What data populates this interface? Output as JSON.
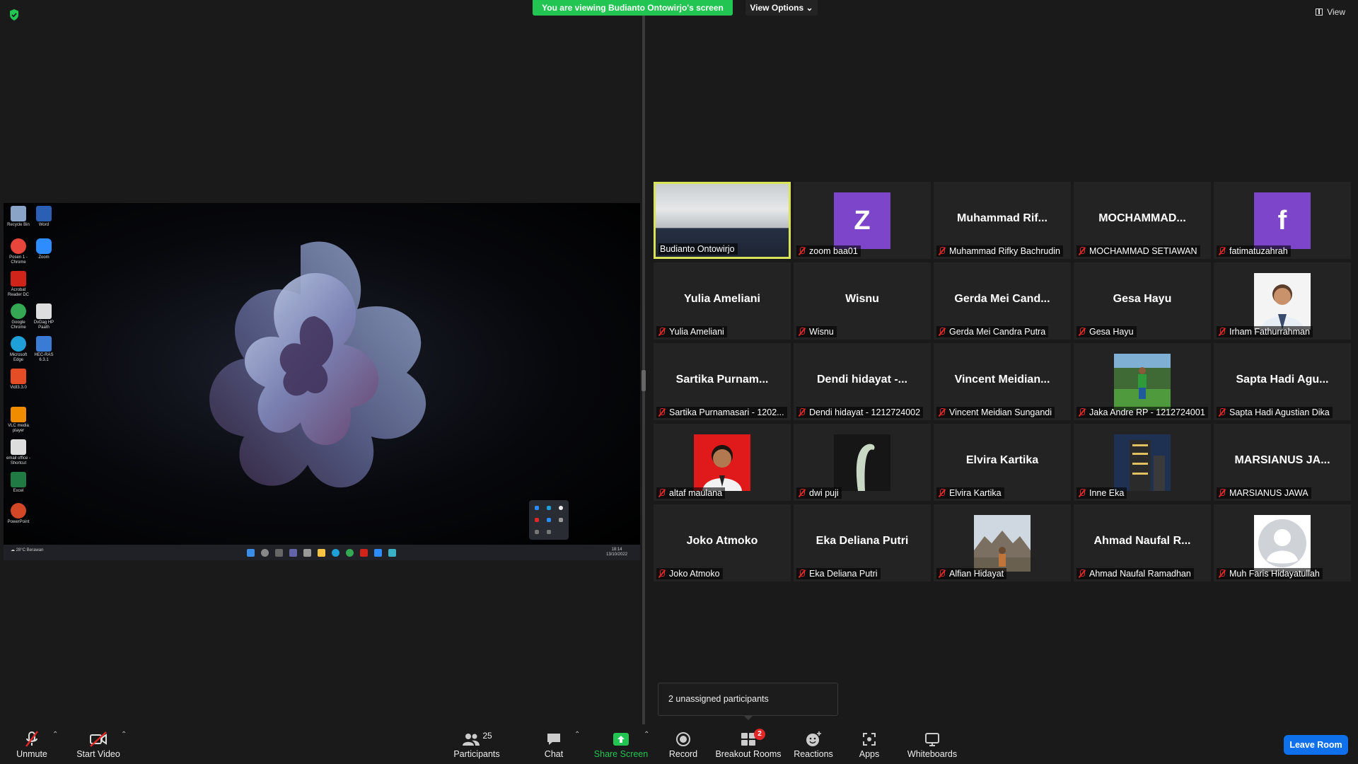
{
  "banner": {
    "text": "You are viewing Budianto Ontowirjo's screen"
  },
  "view_options": {
    "label": "View Options"
  },
  "view": {
    "label": "View"
  },
  "shared_screen": {
    "desktop_icons": [
      {
        "label": "Recycle Bin",
        "color": "#8aa4c8"
      },
      {
        "label": "Word",
        "color": "#2b5fb4"
      },
      {
        "label": "Posen 1 - Chrome",
        "color": "#e8453c"
      },
      {
        "label": "Zoom",
        "color": "#2d8cff"
      },
      {
        "label": "Acrobat Reader DC",
        "color": "#d0231a"
      },
      {
        "label": "Google Chrome",
        "color": "#34a853"
      },
      {
        "label": "DvDag HP Paath",
        "color": "#dddddd"
      },
      {
        "label": "Microsoft Edge",
        "color": "#1fa0d8"
      },
      {
        "label": "HEC-RAS 6.3.1",
        "color": "#3a7bd5"
      },
      {
        "label": "VidI3.3.0",
        "color": "#e44d26"
      },
      {
        "label": "VLC media player",
        "color": "#f08c00"
      },
      {
        "label": "email office - Shortcut",
        "color": "#dddddd"
      },
      {
        "label": "Excel",
        "color": "#1f7a44"
      },
      {
        "label": "PowerPoint",
        "color": "#d24726"
      }
    ],
    "weather": "28°C Berawan",
    "clock_time": "18:14",
    "clock_date": "13/10/2022"
  },
  "participants": [
    {
      "name": "Budianto Ontowirjo",
      "display": "",
      "type": "camera",
      "active": true,
      "muted": false
    },
    {
      "name": "zoom baa01",
      "display": "",
      "type": "initial",
      "initial": "Z",
      "muted": true
    },
    {
      "name": "Muhammad Rifky Bachrudin",
      "display": "Muhammad Rif...",
      "type": "text",
      "muted": true
    },
    {
      "name": "MOCHAMMAD SETIAWAN",
      "display": "MOCHAMMAD...",
      "type": "text",
      "muted": true
    },
    {
      "name": "fatimatuzahrah",
      "display": "",
      "type": "initial",
      "initial": "f",
      "muted": true
    },
    {
      "name": "Yulia Ameliani",
      "display": "Yulia Ameliani",
      "type": "text",
      "muted": true
    },
    {
      "name": "Wisnu",
      "display": "Wisnu",
      "type": "text",
      "muted": true
    },
    {
      "name": "Gerda Mei Candra Putra",
      "display": "Gerda Mei Cand...",
      "type": "text",
      "muted": true
    },
    {
      "name": "Gesa Hayu",
      "display": "Gesa Hayu",
      "type": "text",
      "muted": true
    },
    {
      "name": "Irham Fathurrahman",
      "display": "",
      "type": "photo",
      "photo": "portrait-white",
      "muted": true
    },
    {
      "name": "Sartika Purnamasari - 1202...",
      "display": "Sartika Purnam...",
      "type": "text",
      "muted": true
    },
    {
      "name": "Dendi hidayat - 1212724002",
      "display": "Dendi hidayat -...",
      "type": "text",
      "muted": true
    },
    {
      "name": "Vincent Meidian Sungandi",
      "display": "Vincent Meidian...",
      "type": "text",
      "muted": true
    },
    {
      "name": "Jaka Andre RP - 1212724001",
      "display": "",
      "type": "photo",
      "photo": "field",
      "muted": true
    },
    {
      "name": "Sapta Hadi Agustian Dika",
      "display": "Sapta Hadi Agu...",
      "type": "text",
      "muted": true
    },
    {
      "name": "altaf maulana",
      "display": "",
      "type": "photo",
      "photo": "portrait-red",
      "muted": true
    },
    {
      "name": "dwi puji",
      "display": "",
      "type": "photo",
      "photo": "dark-plant",
      "muted": true
    },
    {
      "name": "Elvira Kartika",
      "display": "Elvira Kartika",
      "type": "text",
      "muted": true
    },
    {
      "name": "Inne Eka",
      "display": "",
      "type": "photo",
      "photo": "building",
      "muted": true
    },
    {
      "name": "MARSIANUS JAWA",
      "display": "MARSIANUS JA...",
      "type": "text",
      "muted": true
    },
    {
      "name": "Joko Atmoko",
      "display": "Joko Atmoko",
      "type": "text",
      "muted": true
    },
    {
      "name": "Eka Deliana Putri",
      "display": "Eka Deliana Putri",
      "type": "text",
      "muted": true
    },
    {
      "name": "Alfian Hidayat",
      "display": "",
      "type": "photo",
      "photo": "temple",
      "muted": true
    },
    {
      "name": "Ahmad Naufal Ramadhan",
      "display": "Ahmad Naufal R...",
      "type": "text",
      "muted": true
    },
    {
      "name": "Muh Faris Hidayatullah",
      "display": "",
      "type": "photo",
      "photo": "default-avatar",
      "muted": true
    }
  ],
  "toast": {
    "text": "2 unassigned participants"
  },
  "toolbar": {
    "unmute": "Unmute",
    "start_video": "Start Video",
    "participants": "Participants",
    "participants_count": "25",
    "chat": "Chat",
    "share_screen": "Share Screen",
    "record": "Record",
    "breakout_rooms": "Breakout Rooms",
    "breakout_badge": "2",
    "reactions": "Reactions",
    "apps": "Apps",
    "whiteboards": "Whiteboards",
    "leave_room": "Leave Room"
  },
  "colors": {
    "share_green": "#23c552",
    "leave_blue": "#0e71eb",
    "active_speaker": "#d8e35a",
    "mute_red": "#e02828",
    "avatar_purple": "#7d45c9"
  }
}
